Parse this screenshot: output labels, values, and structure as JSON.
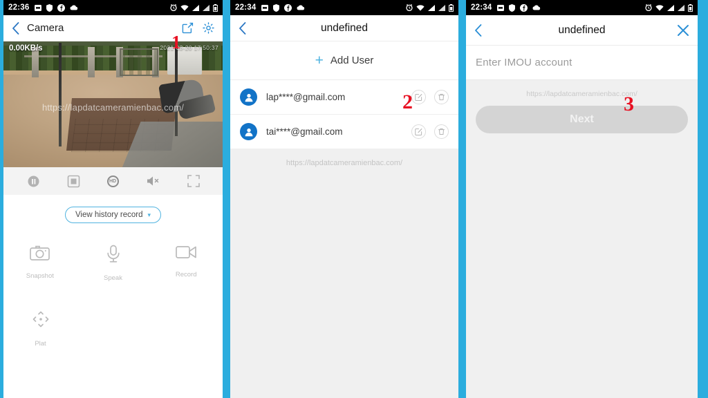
{
  "panels": [
    {
      "step": "1",
      "statusbar": {
        "time": "22:36",
        "left_icons": [
          "screenshot-icon",
          "shield-icon",
          "facebook-icon",
          "cloud-icon"
        ],
        "right_icons": [
          "alarm-icon",
          "wifi-icon",
          "signal-icon",
          "signal-2-icon",
          "battery-icon"
        ]
      },
      "nav": {
        "back": "back-chevron-icon",
        "title": "Camera",
        "actions": [
          "share-icon",
          "gear-icon"
        ]
      },
      "video": {
        "bitrate": "0.00KB/s",
        "timestamp": "2021-03-20 17:50:37",
        "watermark": "https://lapdatcameramienbac.com/"
      },
      "controls": [
        "pause-icon",
        "snapshot-frame-icon",
        "hd-quality-icon",
        "mute-icon",
        "fullscreen-icon"
      ],
      "hd_label": "HD",
      "history": {
        "label": "View history record",
        "caret": "▾"
      },
      "functions": [
        {
          "icon": "camera-icon",
          "label": "Snapshot"
        },
        {
          "icon": "microphone-icon",
          "label": "Speak"
        },
        {
          "icon": "video-record-icon",
          "label": "Record"
        },
        {
          "icon": "pan-tilt-icon",
          "label": "Plat"
        }
      ]
    },
    {
      "step": "2",
      "statusbar": {
        "time": "22:34"
      },
      "nav": {
        "back": "back-chevron-icon",
        "title": "undefined"
      },
      "add_user": {
        "plus": "+",
        "label": "Add User"
      },
      "users": [
        {
          "email": "lap****@gmail.com",
          "edit": "edit-icon",
          "delete": "trash-icon"
        },
        {
          "email": "tai****@gmail.com",
          "edit": "edit-icon",
          "delete": "trash-icon"
        }
      ],
      "watermark": "https://lapdatcameramienbac.com/"
    },
    {
      "step": "3",
      "statusbar": {
        "time": "22:34"
      },
      "nav": {
        "back": "back-chevron-icon",
        "title": "undefined",
        "close": "close-icon"
      },
      "account_field": {
        "placeholder": "Enter IMOU account",
        "value": ""
      },
      "watermark": "https://lapdatcameramienbac.com/",
      "next_button": {
        "label": "Next",
        "enabled": false
      }
    }
  ],
  "colors": {
    "accent": "#2badde",
    "step_marker": "#e81123",
    "link_blue": "#4fb3e0",
    "avatar_blue": "#1273c7",
    "disabled_gray": "#d4d4d4"
  }
}
